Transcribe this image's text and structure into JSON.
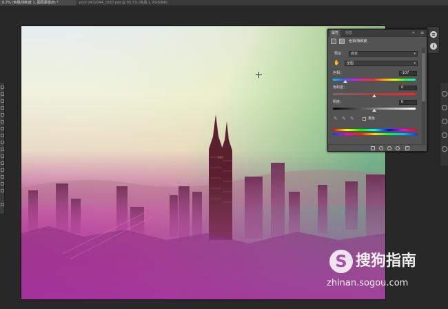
{
  "document_tabs": {
    "active_label": "0.7% (色相/饱和度 1, 图层蒙版/8) *",
    "inactive_label": "pool-2432044_1920.psd @ 55.1% (色相 1, RGB/8#)"
  },
  "panel": {
    "tabs": [
      "属性",
      "信息"
    ],
    "title": "色相/饱和度",
    "preset_label": "预设：",
    "preset_value": "自定",
    "channel_value": "全图",
    "hue_label": "色相：",
    "hue_value": "-107",
    "saturation_label": "饱和度：",
    "saturation_value": "0",
    "lightness_label": "明度：",
    "lightness_value": "0",
    "colorize_label": "着色",
    "hue_slider_fraction": 0.15,
    "saturation_slider_fraction": 0.5,
    "lightness_slider_fraction": 0.5
  },
  "watermark": {
    "brand": "搜狗指南",
    "url": "zhinan.sogou.com"
  },
  "icons": [
    "crosshair-icon",
    "eyedropper-icon",
    "hand-icon",
    "adjustment-layer-icon",
    "mask-icon"
  ]
}
